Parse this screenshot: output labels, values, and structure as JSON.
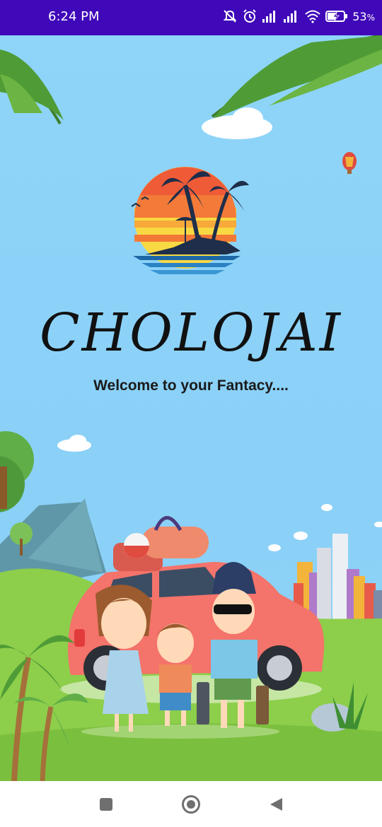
{
  "status_bar": {
    "time": "6:24 PM",
    "battery_percent": "53",
    "battery_unit": "%",
    "battery_level": 0.53,
    "icons": [
      "mute-icon",
      "alarm-icon",
      "signal-icon",
      "signal-icon",
      "wifi-icon",
      "battery-charging-icon"
    ]
  },
  "splash": {
    "title": "CHOLOJAI",
    "tagline": "Welcome to your Fantacy...."
  },
  "nav_bar": {
    "buttons": [
      "recents-button",
      "home-button",
      "back-button"
    ]
  },
  "colors": {
    "status_bar": "#3f08b8",
    "sky": "#8ad0f7",
    "grass": "#8dce4b",
    "car": "#f4736a"
  }
}
